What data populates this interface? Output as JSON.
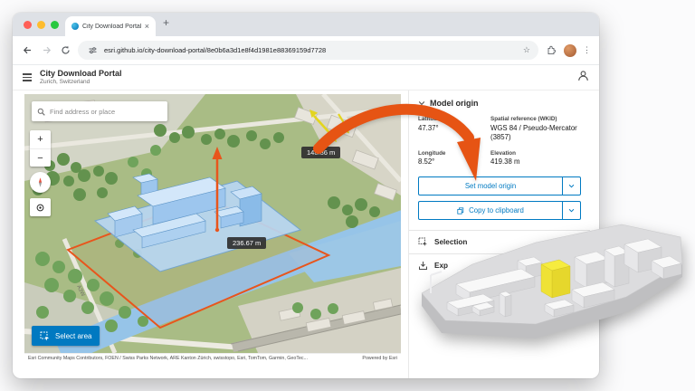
{
  "browser": {
    "tab_title": "City Download Portal",
    "url": "esri.github.io/city-download-portal/8e0b6a3d1e8f4d1981e88369159d7728"
  },
  "app": {
    "title": "City Download Portal",
    "subtitle": "Zurich, Switzerland"
  },
  "map": {
    "search_placeholder": "Find address or place",
    "zoom_in": "+",
    "zoom_out": "−",
    "measurement_height": "148.36 m",
    "measurement_width": "236.67 m",
    "road_label": "A3W",
    "select_area_label": "Select area",
    "attribution": "Esri Community Maps Contributors, FOEN / Swiss Parks Network, ARE Kanton Zürich, swisstopo, Esri, TomTom, Garmin, GeoTec...",
    "powered_by": "Powered by Esri"
  },
  "panel": {
    "model_origin": {
      "title": "Model origin",
      "fields": [
        {
          "label": "Latitude",
          "value": "47.37°"
        },
        {
          "label": "Spatial reference (WKID)",
          "value": "WGS 84 / Pseudo-Mercator (3857)"
        },
        {
          "label": "Longitude",
          "value": "8.52°"
        },
        {
          "label": "Elevation",
          "value": "419.38 m"
        }
      ],
      "set_origin_label": "Set model origin",
      "copy_label": "Copy to clipboard"
    },
    "sections": {
      "selection": "Selection",
      "export": "Exp"
    }
  },
  "colors": {
    "accent_blue": "#007ac2",
    "selection_blue": "#aacdf0",
    "arrow_orange": "#e65414",
    "highlight_yellow": "#f2e73b"
  }
}
